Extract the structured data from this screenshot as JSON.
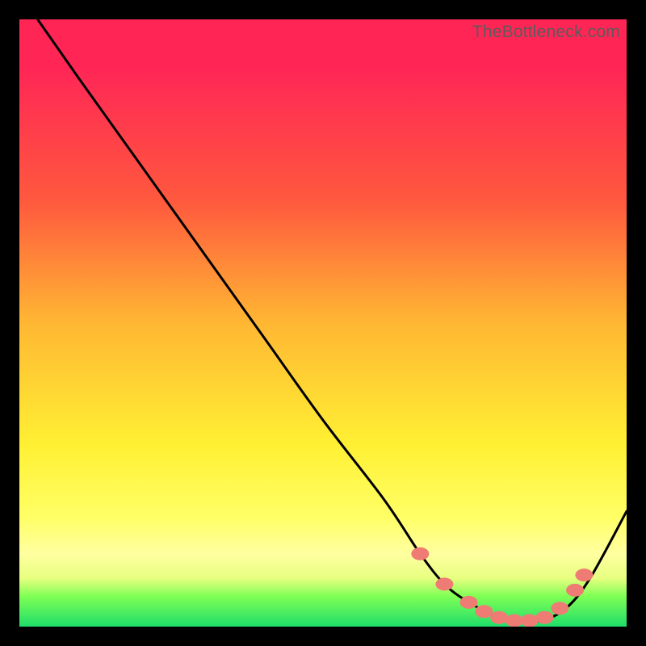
{
  "watermark": "TheBottleneck.com",
  "chart_data": {
    "type": "line",
    "title": "",
    "xlabel": "",
    "ylabel": "",
    "xlim": [
      0,
      100
    ],
    "ylim": [
      0,
      100
    ],
    "series": [
      {
        "name": "bottleneck-curve",
        "x": [
          3,
          10,
          20,
          30,
          40,
          50,
          60,
          66,
          70,
          74,
          78,
          82,
          86,
          90,
          94,
          100
        ],
        "values": [
          100,
          90,
          76,
          62,
          48,
          34,
          21,
          12,
          7,
          4,
          2,
          1,
          1,
          3,
          8,
          19
        ]
      }
    ],
    "markers": {
      "name": "flat-zone-dots",
      "color": "#EF7C74",
      "points": [
        {
          "x": 66,
          "y": 12
        },
        {
          "x": 70,
          "y": 7
        },
        {
          "x": 74,
          "y": 4
        },
        {
          "x": 76.5,
          "y": 2.5
        },
        {
          "x": 79,
          "y": 1.5
        },
        {
          "x": 81.5,
          "y": 1
        },
        {
          "x": 84,
          "y": 1
        },
        {
          "x": 86.5,
          "y": 1.5
        },
        {
          "x": 89,
          "y": 3
        },
        {
          "x": 91.5,
          "y": 6
        },
        {
          "x": 93,
          "y": 8.5
        }
      ]
    }
  }
}
